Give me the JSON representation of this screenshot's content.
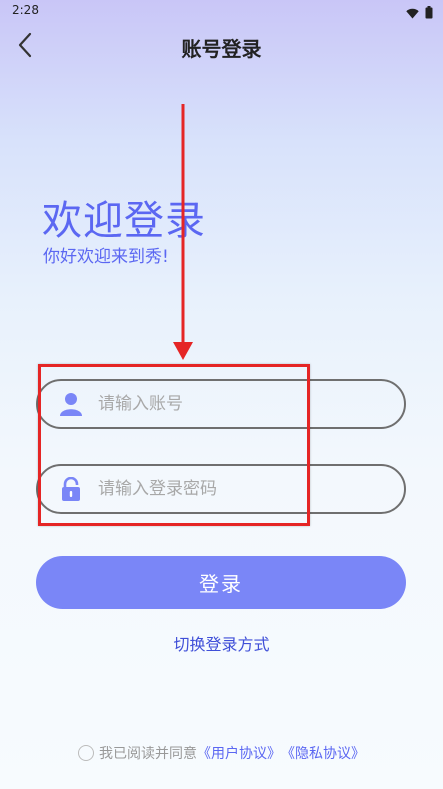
{
  "status_bar": {
    "time": "2:28"
  },
  "nav": {
    "title": "账号登录"
  },
  "welcome": {
    "title": "欢迎登录",
    "subtitle": "你好欢迎来到秀!"
  },
  "form": {
    "account_placeholder": "请输入账号",
    "password_placeholder": "请输入登录密码"
  },
  "login_button": "登录",
  "switch_method": "切换登录方式",
  "agreement": {
    "prefix": "我已阅读并同意",
    "user_agreement": "《用户协议》",
    "privacy_policy": "《隐私协议》",
    "checked": false
  },
  "colors": {
    "accent": "#5b67f2",
    "button": "#7a86f7",
    "annotation": "#e52525"
  },
  "icons": [
    "back-icon",
    "user-icon",
    "lock-icon",
    "wifi-icon",
    "battery-icon"
  ]
}
